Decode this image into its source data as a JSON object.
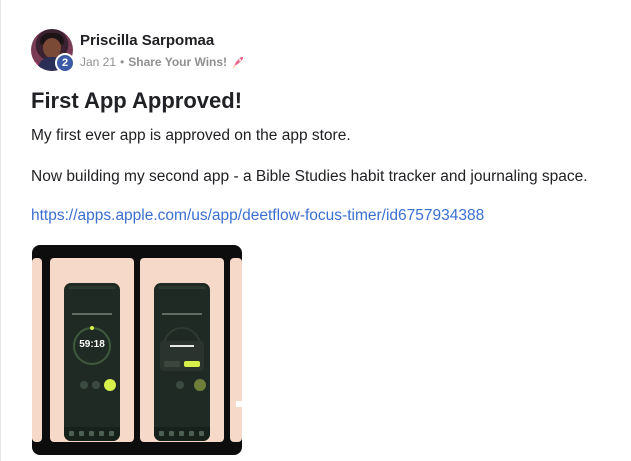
{
  "post": {
    "author": "Priscilla Sarpomaa",
    "level": "2",
    "date": "Jan 21",
    "separator": "•",
    "category": "Share Your Wins!",
    "category_icon": "rocket-icon",
    "title": "First App Approved!",
    "paragraphs": [
      "My first ever app is approved on the app store.",
      "Now building my second app - a Bible Studies habit tracker and journaling space."
    ],
    "link": "https://apps.apple.com/us/app/deetflow-focus-timer/id6757934388",
    "preview": {
      "timer_text": "59:18",
      "accent_color": "#d8f04a",
      "background_color": "#f6d9c9"
    }
  }
}
